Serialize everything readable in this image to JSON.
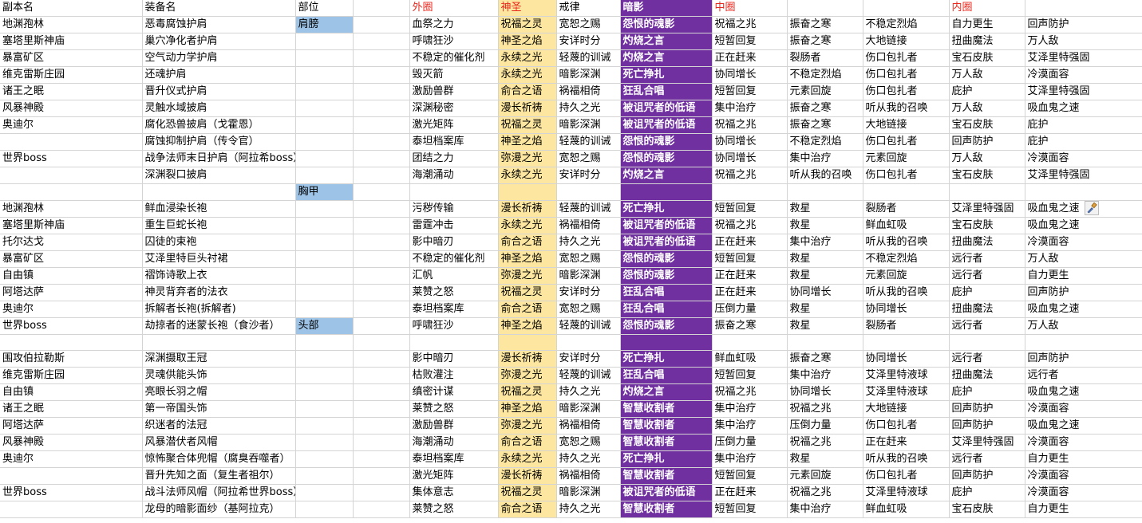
{
  "colors": {
    "header_red": "#e8261c",
    "holy_column_fill": "#fde7a0",
    "shadow_column_fill": "#7030a0",
    "slot_fill": "#9dc3e6",
    "gridline": "#d4d4d4"
  },
  "header": [
    "副本名",
    "装备名",
    "部位",
    "",
    "外圈",
    "神圣",
    "戒律",
    "暗影",
    "中圈",
    "",
    "",
    "内圈",
    ""
  ],
  "rows": [
    [
      "地渊孢林",
      "恶毒腐蚀护肩",
      "肩膀",
      "",
      "血祭之力",
      "祝福之灵",
      "宽恕之赐",
      "怨恨的魂影",
      "祝福之兆",
      "振奋之寒",
      "不稳定烈焰",
      "自力更生",
      "回声防护"
    ],
    [
      "塞塔里斯神庙",
      "巢穴净化者护肩",
      "",
      "",
      "呼啸狂沙",
      "神圣之焰",
      "安详时分",
      "灼烧之言",
      "短暂回复",
      "振奋之寒",
      "大地链接",
      "扭曲魔法",
      "万人敌"
    ],
    [
      "暴富矿区",
      "空气动力学护肩",
      "",
      "",
      "不稳定的催化剂",
      "永续之光",
      "轻蔑的训诫",
      "灼烧之言",
      "正在赶来",
      "裂肠者",
      "伤口包扎者",
      "宝石皮肤",
      "艾泽里特强固"
    ],
    [
      "维克雷斯庄园",
      "还魂护肩",
      "",
      "",
      "毁灭箭",
      "永续之光",
      "暗影深渊",
      "死亡挣扎",
      "协同增长",
      "不稳定烈焰",
      "伤口包扎者",
      "万人敌",
      "冷漠面容"
    ],
    [
      "诸王之眠",
      "晋升仪式护肩",
      "",
      "",
      "激励兽群",
      "俞合之语",
      "祸福相倚",
      "狂乱合唱",
      "短暂回复",
      "元素回旋",
      "伤口包扎者",
      "庇护",
      "艾泽里特强固"
    ],
    [
      "风暴神殿",
      "灵触水域披肩",
      "",
      "",
      "深渊秘密",
      "漫长祈祷",
      "持久之光",
      "被诅咒者的低语",
      "集中治疗",
      "振奋之寒",
      "听从我的召唤",
      "万人敌",
      "吸血鬼之速"
    ],
    [
      "奥迪尔",
      "腐化恐兽披肩（戈霍恩）",
      "",
      "",
      "激光矩阵",
      "祝福之灵",
      "暗影深渊",
      "被诅咒者的低语",
      "祝福之兆",
      "振奋之寒",
      "大地链接",
      "宝石皮肤",
      "庇护"
    ],
    [
      "",
      "腐蚀抑制护肩（传令官）",
      "",
      "",
      "泰坦档案库",
      "神圣之焰",
      "轻蔑的训诫",
      "怨恨的魂影",
      "协同增长",
      "不稳定烈焰",
      "伤口包扎者",
      "回声防护",
      "庇护"
    ],
    [
      "世界boss",
      "战争法师末日护肩（阿拉希boss）",
      "",
      "",
      "团结之力",
      "弥漫之光",
      "宽恕之赐",
      "怨恨的魂影",
      "协同增长",
      "集中治疗",
      "元素回旋",
      "万人敌",
      "冷漠面容"
    ],
    [
      "",
      "深渊裂口披肩",
      "",
      "",
      "海潮涌动",
      "永续之光",
      "安详时分",
      "灼烧之言",
      "祝福之兆",
      "听从我的召唤",
      "伤口包扎者",
      "宝石皮肤",
      "艾泽里特强固"
    ],
    [
      "",
      "",
      "胸甲",
      "",
      "",
      "",
      "",
      "",
      "",
      "",
      "",
      "",
      ""
    ],
    [
      "地渊孢林",
      "鲜血浸染长袍",
      "",
      "",
      "污秽传输",
      "漫长祈祷",
      "轻蔑的训诫",
      "死亡挣扎",
      "短暂回复",
      "救星",
      "裂肠者",
      "艾泽里特强固",
      "吸血鬼之速"
    ],
    [
      "塞塔里斯神庙",
      "重生巨蛇长袍",
      "",
      "",
      "雷霆冲击",
      "永续之光",
      "祸福相倚",
      "被诅咒者的低语",
      "祝福之兆",
      "救星",
      "鲜血虹吸",
      "宝石皮肤",
      "吸血鬼之速"
    ],
    [
      "托尔达戈",
      "囚徒的束袍",
      "",
      "",
      "影中暗刃",
      "俞合之语",
      "持久之光",
      "被诅咒者的低语",
      "正在赶来",
      "集中治疗",
      "听从我的召唤",
      "扭曲魔法",
      "冷漠面容"
    ],
    [
      "暴富矿区",
      "艾泽里特巨头衬裙",
      "",
      "",
      "不稳定的催化剂",
      "神圣之焰",
      "宽恕之赐",
      "怨恨的魂影",
      "短暂回复",
      "救星",
      "不稳定烈焰",
      "远行者",
      "万人敌"
    ],
    [
      "自由镇",
      "褶饰诗歌上衣",
      "",
      "",
      "汇帆",
      "弥漫之光",
      "暗影深渊",
      "怨恨的魂影",
      "正在赶来",
      "救星",
      "元素回旋",
      "远行者",
      "自力更生"
    ],
    [
      "阿塔达萨",
      "神灵背弃者的法衣",
      "",
      "",
      "莱赞之怒",
      "祝福之灵",
      "安详时分",
      "狂乱合唱",
      "正在赶来",
      "协同增长",
      "听从我的召唤",
      "庇护",
      "回声防护"
    ],
    [
      "奥迪尔",
      "拆解者长袍(拆解者)",
      "",
      "",
      "泰坦档案库",
      "俞合之语",
      "宽恕之赐",
      "狂乱合唱",
      "压倒力量",
      "救星",
      "协同增长",
      "扭曲魔法",
      "吸血鬼之速"
    ],
    [
      "世界boss",
      "劫掠者的迷蒙长袍（食沙者）",
      "头部",
      "",
      "呼啸狂沙",
      "神圣之焰",
      "轻蔑的训诫",
      "怨恨的魂影",
      "振奋之寒",
      "救星",
      "裂肠者",
      "远行者",
      "万人敌"
    ],
    [
      "",
      "",
      "",
      "",
      "",
      "",
      "",
      "",
      "",
      "",
      "",
      "",
      ""
    ],
    [
      "围攻伯拉勒斯",
      "深渊摄取王冠",
      "",
      "",
      "影中暗刃",
      "漫长祈祷",
      "安详时分",
      "死亡挣扎",
      "鲜血虹吸",
      "振奋之寒",
      "协同增长",
      "远行者",
      "回声防护"
    ],
    [
      "维克雷斯庄园",
      "灵魂供能头饰",
      "",
      "",
      "枯败灌注",
      "弥漫之光",
      "轻蔑的训诫",
      "狂乱合唱",
      "短暂回复",
      "集中治疗",
      "艾泽里特液球",
      "扭曲魔法",
      "远行者"
    ],
    [
      "自由镇",
      "亮眼长羽之帽",
      "",
      "",
      "缜密计谋",
      "祝福之灵",
      "持久之光",
      "灼烧之言",
      "祝福之兆",
      "协同增长",
      "艾泽里特液球",
      "庇护",
      "吸血鬼之速"
    ],
    [
      "诸王之眠",
      "第一帝国头饰",
      "",
      "",
      "莱赞之怒",
      "神圣之焰",
      "暗影深渊",
      "智慧收割者",
      "集中治疗",
      "祝福之兆",
      "大地链接",
      "回声防护",
      "冷漠面容"
    ],
    [
      "阿塔达萨",
      "织迷者的法冠",
      "",
      "",
      "激励兽群",
      "弥漫之光",
      "祸福相倚",
      "智慧收割者",
      "集中治疗",
      "压倒力量",
      "伤口包扎者",
      "回声防护",
      "吸血鬼之速"
    ],
    [
      "风暴神殿",
      "风暴潜伏者风帽",
      "",
      "",
      "海潮涌动",
      "俞合之语",
      "宽恕之赐",
      "智慧收割者",
      "压倒力量",
      "祝福之兆",
      "正在赶来",
      "艾泽里特强固",
      "冷漠面容"
    ],
    [
      "奥迪尔",
      "惊怖聚合体兜帽（腐臭吞噬者）",
      "",
      "",
      "泰坦档案库",
      "永续之光",
      "持久之光",
      "死亡挣扎",
      "集中治疗",
      "救星",
      "听从我的召唤",
      "远行者",
      "自力更生"
    ],
    [
      "",
      "晋升先知之面（复生者祖尔）",
      "",
      "",
      "激光矩阵",
      "漫长祈祷",
      "祸福相倚",
      "智慧收割者",
      "短暂回复",
      "元素回旋",
      "伤口包扎者",
      "回声防护",
      "冷漠面容"
    ],
    [
      "世界boss",
      "战斗法师风帽（阿拉希世界boss）",
      "",
      "",
      "集体意志",
      "祝福之灵",
      "暗影深渊",
      "被诅咒者的低语",
      "正在赶来",
      "祝福之兆",
      "艾泽里特液球",
      "庇护",
      "冷漠面容"
    ],
    [
      "",
      "龙母的暗影面纱（基阿拉克）",
      "",
      "",
      "莱赞之怒",
      "俞合之语",
      "持久之光",
      "智慧收割者",
      "短暂回复",
      "集中治疗",
      "鲜血虹吸",
      "宝石皮肤",
      "自力更生"
    ]
  ]
}
